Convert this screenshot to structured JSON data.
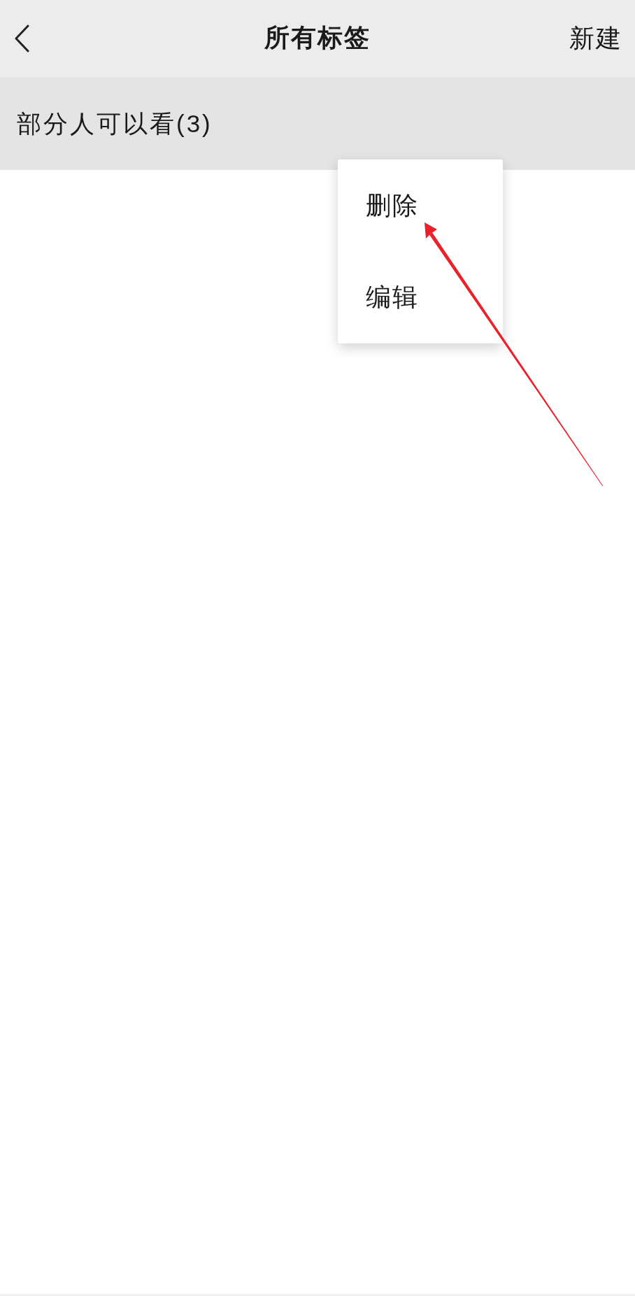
{
  "header": {
    "title": "所有标签",
    "action": "新建"
  },
  "tags": [
    {
      "label": "部分人可以看(3)"
    }
  ],
  "context_menu": {
    "items": [
      {
        "label": "删除"
      },
      {
        "label": "编辑"
      }
    ]
  }
}
